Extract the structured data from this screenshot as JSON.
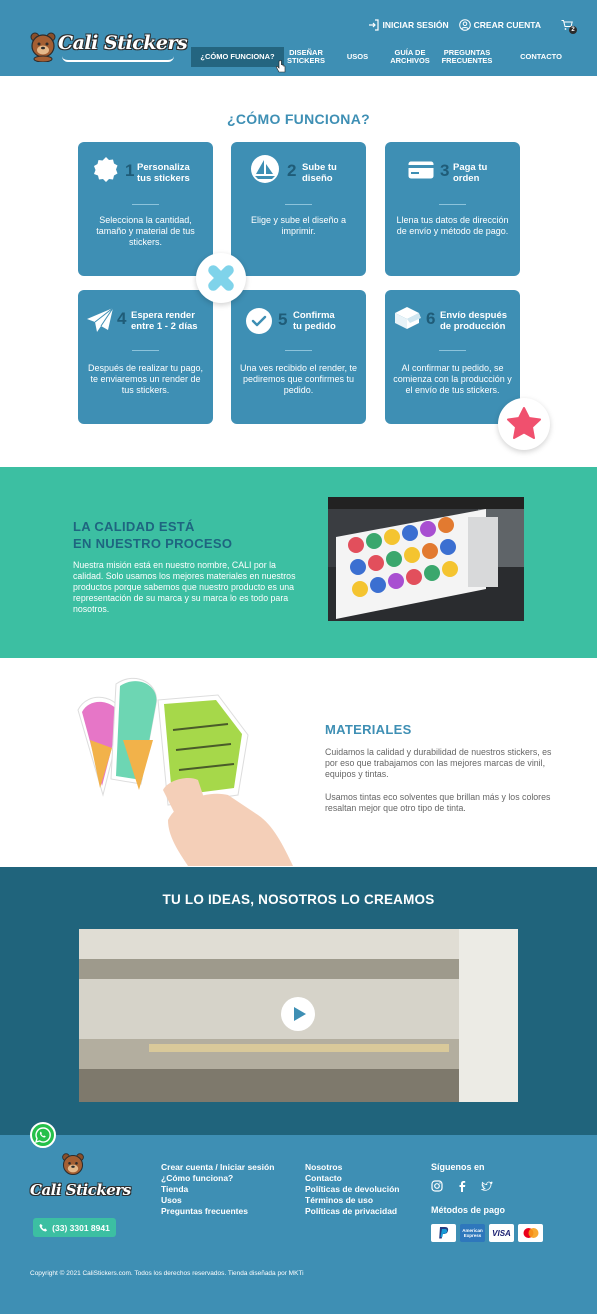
{
  "brand": {
    "name": "Cali Stickers"
  },
  "topbar": {
    "login": "INICIAR SESIÓN",
    "register": "CREAR CUENTA",
    "cart_count": "2"
  },
  "nav": [
    {
      "label": "¿CÓMO FUNCIONA?",
      "active": true
    },
    {
      "label": "DISEÑAR STICKERS"
    },
    {
      "label": "USOS"
    },
    {
      "label": "GUÍA DE ARCHIVOS"
    },
    {
      "label": "PREGUNTAS FRECUENTES"
    },
    {
      "label": "CONTACTO"
    }
  ],
  "how": {
    "title": "¿CÓMO FUNCIONA?",
    "steps": [
      {
        "num": "1",
        "title": "Personaliza tus stickers",
        "desc": "Selecciona la cantidad, tamaño y material de tus stickers.",
        "icon": "badge-icon"
      },
      {
        "num": "2",
        "title": "Sube tu diseño",
        "desc": "Elige y sube el diseño a imprimir.",
        "icon": "sailboat-icon"
      },
      {
        "num": "3",
        "title": "Paga tu orden",
        "desc": "Llena tus datos de dirección de envío y método de pago.",
        "icon": "credit-card-icon"
      },
      {
        "num": "4",
        "title": "Espera render entre 1 - 2 días",
        "desc": "Después de realizar tu pago, te enviaremos un render de tus stickers.",
        "icon": "paper-plane-icon"
      },
      {
        "num": "5",
        "title": "Confirma tu pedido",
        "desc": "Una ves recibido el render, te pediremos que confirmes tu pedido.",
        "icon": "check-circle-icon"
      },
      {
        "num": "6",
        "title": "Envío después de producción",
        "desc": "Al confirmar tu pedido, se comienza con la producción y el envío de tus stickers.",
        "icon": "box-icon"
      }
    ]
  },
  "quality": {
    "title_line1": "LA CALIDAD ESTÁ",
    "title_line2": "EN NUESTRO PROCESO",
    "text": "Nuestra misión está en nuestro nombre, CALI por la calidad. Solo usamos los mejores materiales en nuestros productos porque sabemos que nuestro producto es una representación de su marca y su marca lo es todo para nosotros."
  },
  "materials": {
    "title": "MATERIALES",
    "text1": "Cuidamos la calidad y durabilidad de nuestros stickers, es por eso que trabajamos con las mejores marcas de vinil, equipos y tintas.",
    "text2": "Usamos tintas eco solventes que brillan más y los colores resaltan mejor que otro tipo de tinta."
  },
  "video": {
    "title": "TU LO IDEAS, NOSOTROS LO CREAMOS"
  },
  "footer": {
    "phone": "(33) 3301 8941",
    "col1": [
      "Crear cuenta / Iniciar sesión",
      "¿Cómo funciona?",
      "Tienda",
      "Usos",
      "Preguntas frecuentes"
    ],
    "col2": [
      "Nosotros",
      "Contacto",
      "Políticas de devolución",
      "Términos de uso",
      "Políticas de privacidad"
    ],
    "follow": "Síguenos en",
    "payments_title": "Métodos de pago",
    "payments": [
      "PayPal",
      "American Express",
      "VISA",
      "Mastercard"
    ],
    "copyright": "Copyright © 2021 CaliStickers.com. Todos los derechos reservados. Tienda diseñada por MKTi"
  },
  "colors": {
    "primary": "#3e8fb4",
    "dark": "#20647c",
    "teal": "#3cbfa2",
    "accent_pink": "#f0506e"
  }
}
